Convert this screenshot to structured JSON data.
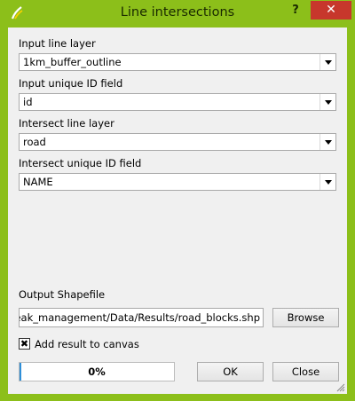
{
  "window": {
    "title": "Line intersections",
    "help_label": "?",
    "close_label": "✕",
    "accent_color": "#8cbf1a"
  },
  "fields": {
    "input_line_layer_label": "Input line layer",
    "input_line_layer_value": "1km_buffer_outline",
    "input_unique_id_label": "Input unique ID field",
    "input_unique_id_value": "id",
    "intersect_line_layer_label": "Intersect line layer",
    "intersect_line_layer_value": "road",
    "intersect_unique_id_label": "Intersect unique ID field",
    "intersect_unique_id_value": "NAME"
  },
  "output": {
    "label": "Output Shapefile",
    "path": "e_outbreak_management/Data/Results/road_blocks.shp",
    "browse_label": "Browse"
  },
  "add_to_canvas": {
    "label": "Add result to canvas",
    "checked": true,
    "check_mark": "✖"
  },
  "progress": {
    "value": 0,
    "text": "0%"
  },
  "buttons": {
    "ok_label": "OK",
    "close_label": "Close"
  }
}
